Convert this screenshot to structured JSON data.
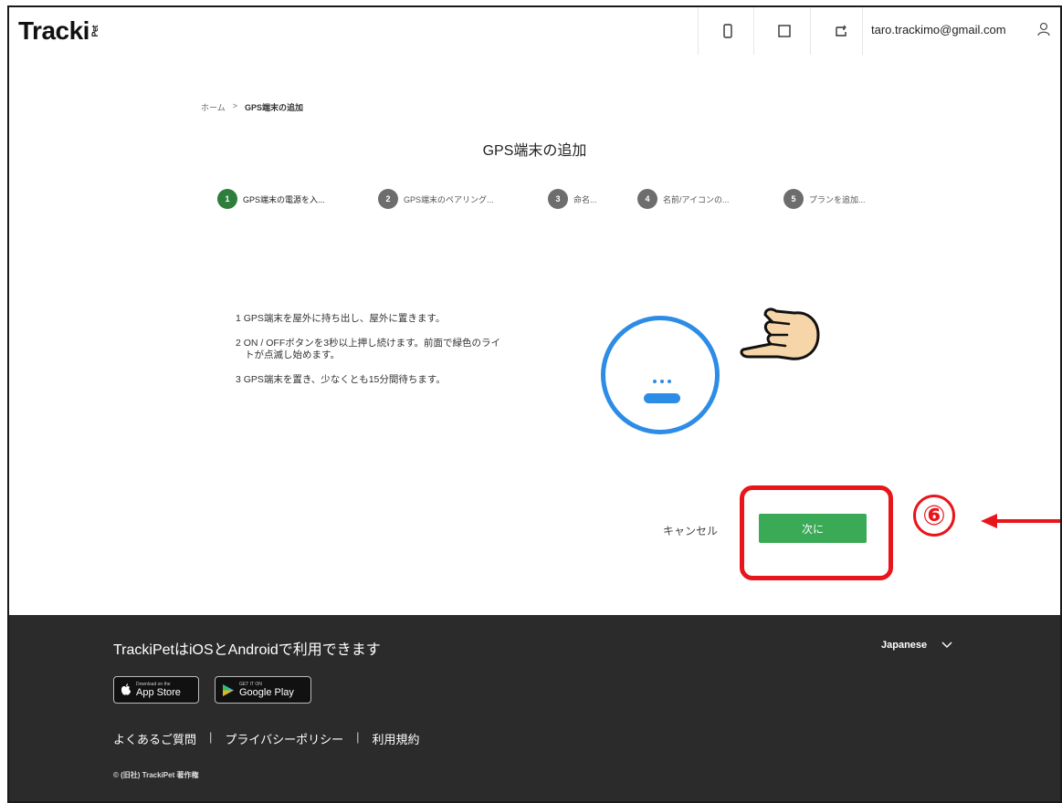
{
  "header": {
    "logo": "Tracki",
    "logo_suffix": "Pet",
    "email": "taro.trackimo@gmail.com",
    "icons": [
      "phone-icon",
      "square-icon",
      "refresh-icon",
      "user-icon"
    ]
  },
  "breadcrumb": {
    "home": "ホーム",
    "separator": ">",
    "current": "GPS端末の追加"
  },
  "page": {
    "title": "GPS端末の追加"
  },
  "stepper": {
    "steps": [
      {
        "number": "1",
        "label": "GPS端末の電源を入..."
      },
      {
        "number": "2",
        "label": "GPS端末のペアリング..."
      },
      {
        "number": "3",
        "label": "命名..."
      },
      {
        "number": "4",
        "label": "名前/アイコンの..."
      },
      {
        "number": "5",
        "label": "プランを追加..."
      }
    ]
  },
  "instructions": [
    "1 GPS端末を屋外に持ち出し、屋外に置きます。",
    "2 ON / OFFボタンを3秒以上押し続けます。前面で緑色のライトが点滅し始めます。",
    "3 GPS端末を置き、少なくとも15分間待ちます。"
  ],
  "actions": {
    "cancel": "キャンセル",
    "next": "次に"
  },
  "annotation": {
    "callout": "⑥",
    "highlight_color": "#e8151b"
  },
  "footer": {
    "title": "TrackiPetはiOSとAndroidで利用できます",
    "language": "Japanese",
    "app_store_small": "Download on the",
    "app_store": "App Store",
    "google_play_small": "GET IT ON",
    "google_play": "Google Play",
    "links": [
      "よくあるご質問",
      "プライバシーポリシー",
      "利用規約"
    ],
    "copyright": "© (旧社) TrackiPet 著作権"
  },
  "colors": {
    "accent_green": "#3aaa57",
    "step_active": "#2e7d3a",
    "device_blue": "#2d8ce6",
    "footer_bg": "#2b2b2b"
  }
}
